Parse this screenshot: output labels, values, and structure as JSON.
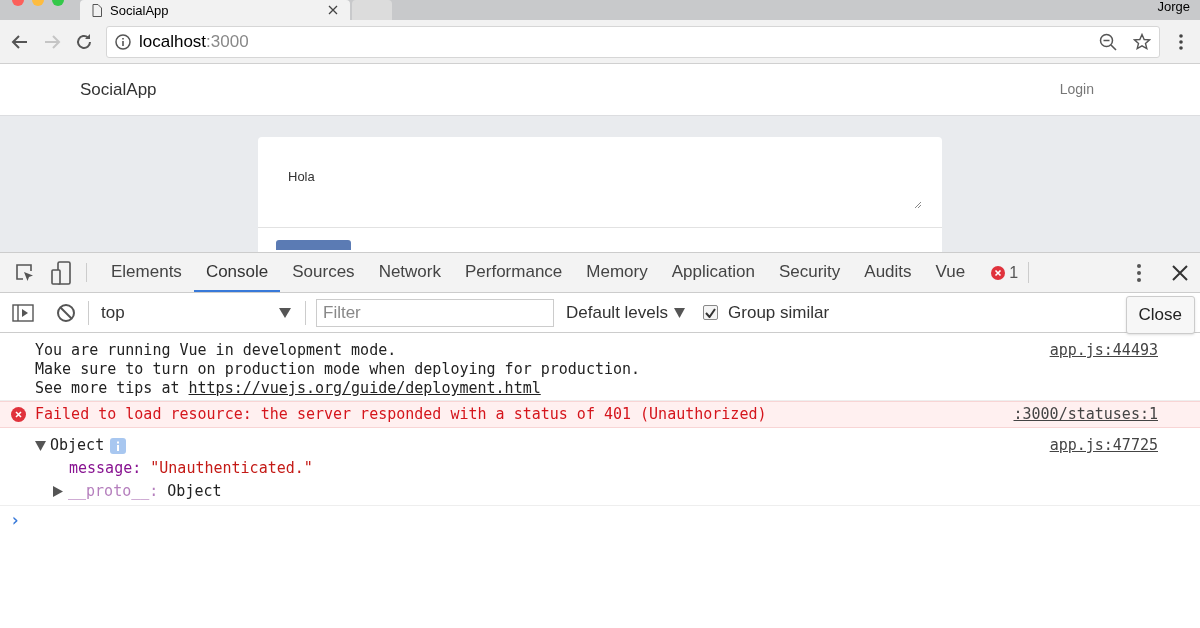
{
  "browser": {
    "tabs": [
      {
        "title": "SocialApp",
        "selected": true
      },
      {
        "selected": false
      }
    ],
    "profile": "Jorge",
    "address": {
      "host": "localhost",
      "port": ":3000"
    }
  },
  "page": {
    "brand": "SocialApp",
    "nav_link": "Login",
    "post_field": {
      "value": "Hola"
    }
  },
  "devtools": {
    "tabs": [
      {
        "label": "Elements",
        "selected": false
      },
      {
        "label": "Console",
        "selected": true
      },
      {
        "label": "Sources",
        "selected": false
      },
      {
        "label": "Network",
        "selected": false
      },
      {
        "label": "Performance",
        "selected": false
      },
      {
        "label": "Memory",
        "selected": false
      },
      {
        "label": "Application",
        "selected": false
      },
      {
        "label": "Security",
        "selected": false
      },
      {
        "label": "Audits",
        "selected": false
      },
      {
        "label": "Vue",
        "selected": false
      }
    ],
    "error_count": "1",
    "context": "top",
    "filter": {
      "placeholder": "Filter"
    },
    "levels": "Default levels",
    "group_similar": {
      "label": "Group similar",
      "checked": true
    },
    "tooltip": "Close",
    "messages": [
      {
        "kind": "log",
        "lines": [
          "You are running Vue in development mode.",
          "Make sure to turn on production mode when deploying for production."
        ],
        "link_prefix": "See more tips at ",
        "link": "https://vuejs.org/guide/deployment.html",
        "source": "app.js:44493"
      },
      {
        "kind": "error",
        "text": "Failed to load resource: the server responded with a status of 401 (Unauthorized)",
        "source": ":3000/statuses:1"
      },
      {
        "kind": "object",
        "label": "Object",
        "expanded": true,
        "source": "app.js:47725",
        "children": [
          {
            "kind": "primitive",
            "key": "message:",
            "value": "\"Unauthenticated.\""
          },
          {
            "kind": "expandable",
            "key": "__proto__:",
            "value": "Object",
            "expanded": false
          }
        ]
      }
    ],
    "prompt": "›"
  }
}
